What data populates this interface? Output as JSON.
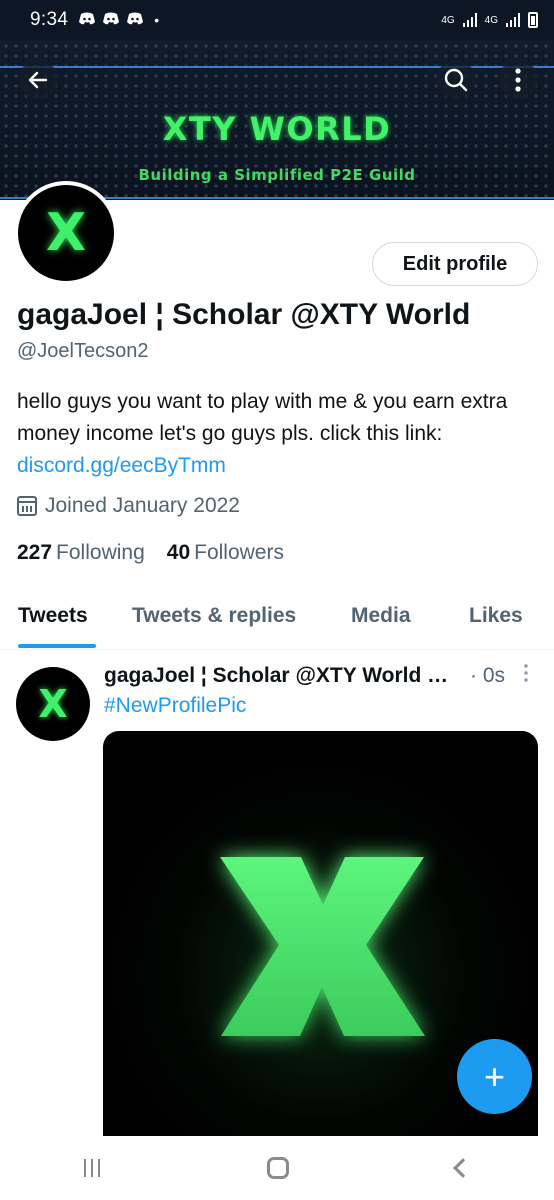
{
  "status_bar": {
    "time": "9:34",
    "dot": "•",
    "net1": "4G",
    "net2": "4G"
  },
  "banner": {
    "title": "XTY WORLD",
    "subtitle": "Building a Simplified P2E Guild",
    "accent_color": "#44f26a"
  },
  "avatar": {
    "letter": "X"
  },
  "profile": {
    "edit_label": "Edit profile",
    "name": "gagaJoel ¦ Scholar @XTY World",
    "handle": "@JoelTecson2",
    "bio_text": "hello guys you want to play with me & you earn extra money income let's go guys pls. click this link: ",
    "bio_link": "discord.gg/eecByTmm",
    "joined": "Joined January 2022",
    "following_count": "227",
    "following_label": "Following",
    "followers_count": "40",
    "followers_label": "Followers"
  },
  "tabs": [
    {
      "label": "Tweets",
      "active": true
    },
    {
      "label": "Tweets & replies",
      "active": false
    },
    {
      "label": "Media",
      "active": false
    },
    {
      "label": "Likes",
      "active": false
    }
  ],
  "tweet": {
    "author": "gagaJoel ¦ Scholar @XTY World …",
    "time": "· 0s",
    "hashtag": "#NewProfilePic",
    "media_letter": "X"
  },
  "fab": {
    "symbol": "+",
    "color": "#1d9bf0"
  },
  "icons": [
    "back-arrow-icon",
    "search-icon",
    "more-vertical-icon",
    "calendar-icon",
    "plus-icon",
    "recents-icon",
    "home-icon",
    "back-nav-icon"
  ]
}
